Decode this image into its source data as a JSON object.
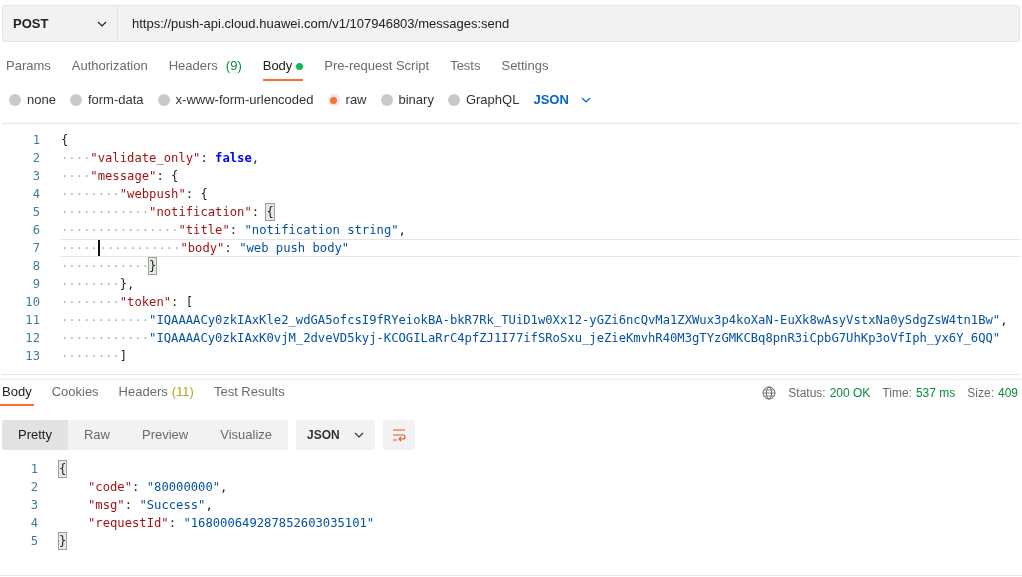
{
  "request": {
    "method": "POST",
    "url": "https://push-api.cloud.huawei.com/v1/107946803/messages:send"
  },
  "request_tabs": [
    {
      "label": "Params",
      "selected": false
    },
    {
      "label": "Authorization",
      "selected": false
    },
    {
      "label": "Headers",
      "count": "(9)",
      "selected": false
    },
    {
      "label": "Body",
      "dot": true,
      "selected": true
    },
    {
      "label": "Pre-request Script",
      "selected": false
    },
    {
      "label": "Tests",
      "selected": false
    },
    {
      "label": "Settings",
      "selected": false
    }
  ],
  "body_types": [
    {
      "label": "none",
      "selected": false
    },
    {
      "label": "form-data",
      "selected": false
    },
    {
      "label": "x-www-form-urlencoded",
      "selected": false
    },
    {
      "label": "raw",
      "selected": true
    },
    {
      "label": "binary",
      "selected": false
    },
    {
      "label": "GraphQL",
      "selected": false
    }
  ],
  "body_format": "JSON",
  "editor": {
    "lines": [
      {
        "number": "1",
        "active": false,
        "tokens": [
          {
            "kind": "punct",
            "text": "{"
          }
        ]
      },
      {
        "number": "2",
        "active": false,
        "tokens": [
          {
            "kind": "ws",
            "text": "····"
          },
          {
            "kind": "key",
            "text": "\"validate_only\""
          },
          {
            "kind": "punct",
            "text": ": "
          },
          {
            "kind": "bool",
            "text": "false"
          },
          {
            "kind": "punct",
            "text": ","
          }
        ]
      },
      {
        "number": "3",
        "active": false,
        "tokens": [
          {
            "kind": "ws",
            "text": "····"
          },
          {
            "kind": "key",
            "text": "\"message\""
          },
          {
            "kind": "punct",
            "text": ": {"
          }
        ]
      },
      {
        "number": "4",
        "active": false,
        "tokens": [
          {
            "kind": "ws",
            "text": "········"
          },
          {
            "kind": "key",
            "text": "\"webpush\""
          },
          {
            "kind": "punct",
            "text": ": {"
          }
        ]
      },
      {
        "number": "5",
        "active": false,
        "tokens": [
          {
            "kind": "ws",
            "text": "············"
          },
          {
            "kind": "key",
            "text": "\"notification\""
          },
          {
            "kind": "punct",
            "text": ": "
          },
          {
            "kind": "match",
            "text": "{"
          }
        ]
      },
      {
        "number": "6",
        "active": false,
        "tokens": [
          {
            "kind": "ws",
            "text": "················"
          },
          {
            "kind": "key",
            "text": "\"title\""
          },
          {
            "kind": "punct",
            "text": ": "
          },
          {
            "kind": "string",
            "text": "\"notification string\""
          },
          {
            "kind": "punct",
            "text": ","
          }
        ]
      },
      {
        "number": "7",
        "active": true,
        "tokens": [
          {
            "kind": "ws",
            "text": "·····"
          },
          {
            "kind": "ws",
            "text": "···········"
          },
          {
            "kind": "key",
            "text": "\"body\""
          },
          {
            "kind": "punct",
            "text": ": "
          },
          {
            "kind": "string",
            "text": "\"web push body\""
          }
        ]
      },
      {
        "number": "8",
        "active": false,
        "tokens": [
          {
            "kind": "ws",
            "text": "············"
          },
          {
            "kind": "match",
            "text": "}"
          }
        ]
      },
      {
        "number": "9",
        "active": false,
        "tokens": [
          {
            "kind": "ws",
            "text": "········"
          },
          {
            "kind": "punct",
            "text": "},"
          }
        ]
      },
      {
        "number": "10",
        "active": false,
        "tokens": [
          {
            "kind": "ws",
            "text": "········"
          },
          {
            "kind": "key",
            "text": "\"token\""
          },
          {
            "kind": "punct",
            "text": ": ["
          }
        ]
      },
      {
        "number": "11",
        "active": false,
        "tokens": [
          {
            "kind": "ws",
            "text": "············"
          },
          {
            "kind": "string",
            "text": "\"IQAAAACy0zkIAxKle2_wdGA5ofcsI9fRYeiokBA-bkR7Rk_TUiD1w0Xx12-yGZi6ncQvMa1ZXWux3p4koXaN-EuXk8wAsyVstxNa0ySdgZsW4tn1Bw\""
          },
          {
            "kind": "punct",
            "text": ","
          }
        ]
      },
      {
        "number": "12",
        "active": false,
        "tokens": [
          {
            "kind": "ws",
            "text": "············"
          },
          {
            "kind": "string",
            "text": "\"IQAAAACy0zkIAxK0vjM_2dveVD5kyj-KCOGILaRrC4pfZJ1I77ifSRoSxu_jeZieKmvhR40M3gTYzGMKCBq8pnR3iCpbG7UhKp3oVfIph_yx6Y_6QQ\""
          }
        ]
      },
      {
        "number": "13",
        "active": false,
        "tokens": [
          {
            "kind": "ws",
            "text": "········"
          },
          {
            "kind": "punct",
            "text": "]"
          }
        ]
      }
    ]
  },
  "response_tabs": [
    {
      "label": "Body",
      "selected": true
    },
    {
      "label": "Cookies",
      "selected": false
    },
    {
      "label": "Headers",
      "count": "(11)",
      "selected": false
    },
    {
      "label": "Test Results",
      "selected": false
    }
  ],
  "status": [
    {
      "label": "Status:",
      "value": "200 OK"
    },
    {
      "label": "Time:",
      "value": "537 ms"
    },
    {
      "label": "Size:",
      "value": "409"
    }
  ],
  "view_modes": [
    {
      "label": "Pretty",
      "selected": true
    },
    {
      "label": "Raw",
      "selected": false
    },
    {
      "label": "Preview",
      "selected": false
    },
    {
      "label": "Visualize",
      "selected": false
    }
  ],
  "response_format": "JSON",
  "response": {
    "lines": [
      {
        "number": "1",
        "kind": "brace",
        "active": false,
        "tokens": [
          {
            "kind": "match",
            "text": "{"
          }
        ]
      },
      {
        "number": "2",
        "kind": "member",
        "active": false,
        "tokens": [
          {
            "kind": "key",
            "text": "\"code\""
          },
          {
            "kind": "punct",
            "text": ": "
          },
          {
            "kind": "string",
            "text": "\"80000000\""
          },
          {
            "kind": "punct",
            "text": ","
          }
        ]
      },
      {
        "number": "3",
        "kind": "member",
        "active": false,
        "tokens": [
          {
            "kind": "key",
            "text": "\"msg\""
          },
          {
            "kind": "punct",
            "text": ": "
          },
          {
            "kind": "string",
            "text": "\"Success\""
          },
          {
            "kind": "punct",
            "text": ","
          }
        ]
      },
      {
        "number": "4",
        "kind": "member",
        "active": false,
        "tokens": [
          {
            "kind": "key",
            "text": "\"requestId\""
          },
          {
            "kind": "punct",
            "text": ": "
          },
          {
            "kind": "string",
            "text": "\"168000649287852603035101\""
          }
        ]
      },
      {
        "number": "5",
        "kind": "brace",
        "active": false,
        "tokens": [
          {
            "kind": "match",
            "text": "}"
          }
        ]
      }
    ]
  }
}
